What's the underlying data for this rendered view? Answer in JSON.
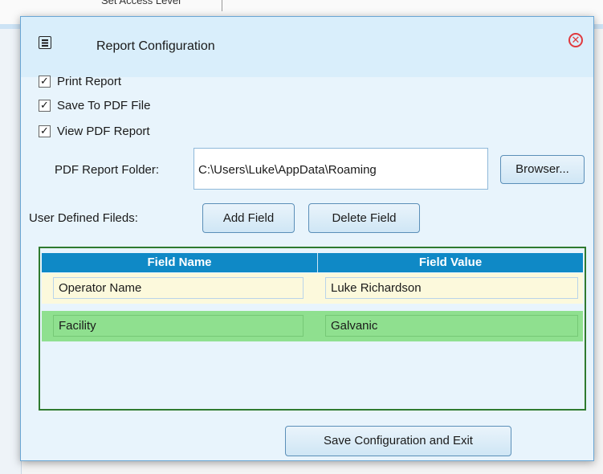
{
  "background": {
    "partial_text": "Set Access Level"
  },
  "dialog": {
    "title": "Report Configuration",
    "icon": "document-list-icon",
    "close_icon": "close-circle-icon",
    "checkboxes": [
      {
        "label": "Print Report",
        "checked": true
      },
      {
        "label": "Save To PDF File",
        "checked": true
      },
      {
        "label": "View PDF Report",
        "checked": true
      }
    ],
    "pdf_folder": {
      "label": "PDF Report Folder:",
      "value": "C:\\Users\\Luke\\AppData\\Roaming",
      "browse_label": "Browser..."
    },
    "user_fields": {
      "label": "User Defined Fileds:",
      "add_label": "Add Field",
      "delete_label": "Delete Field"
    },
    "grid": {
      "columns": [
        "Field Name",
        "Field Value"
      ],
      "rows": [
        {
          "name": "Operator Name",
          "value": "Luke Richardson"
        },
        {
          "name": "Facility",
          "value": "Galvanic"
        }
      ]
    },
    "save_label": "Save Configuration and Exit"
  },
  "colors": {
    "header_blue": "#0f89c6",
    "row_highlight": "#8fe08f",
    "row_default": "#fcf9dc",
    "close_red": "#e0393e",
    "dialog_bg": "#e8f4fc"
  }
}
